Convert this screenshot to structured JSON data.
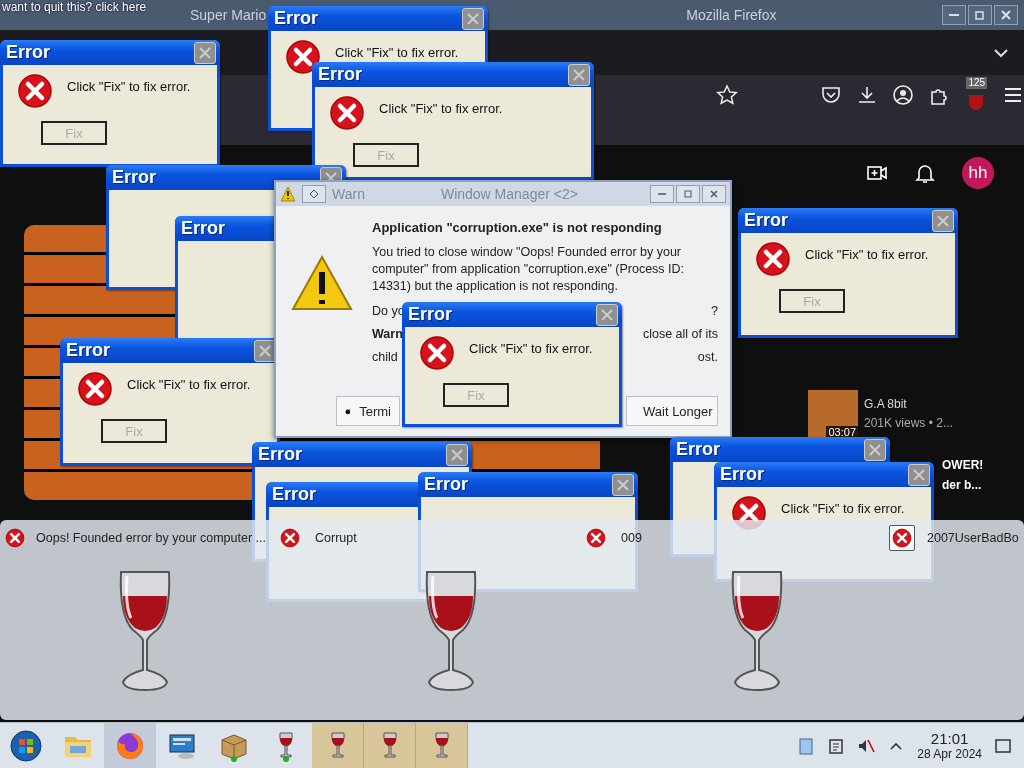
{
  "overlay_link": "want to quit this? click here",
  "browser": {
    "title_left": "Super Mario",
    "title_right": "Mozilla Firefox",
    "extension_badge": "125",
    "avatar": "hh",
    "video": {
      "channel": "G.A 8bit",
      "meta": "201K views • 2...",
      "duration": "03:07"
    },
    "fragments": [
      "OWER!",
      "der b..."
    ]
  },
  "error_windows": [
    {
      "title": "Error",
      "message": "Click \"Fix\" to fix error.",
      "button": "Fix"
    },
    {
      "title": "Error",
      "message": "Click \"Fix\" to fix error."
    },
    {
      "title": "Error",
      "message": "Click \"Fix\" to fix error.",
      "button": "Fix"
    },
    {
      "title": "Error"
    },
    {
      "title": "Error"
    },
    {
      "title": "Error",
      "message": "Click \"Fix\" to fix error.",
      "button": "Fix"
    },
    {
      "title": "Error",
      "message": "Click \"Fix\" to fix error.",
      "button": "Fix"
    },
    {
      "title": "Error"
    },
    {
      "title": "Error"
    },
    {
      "title": "Error"
    },
    {
      "title": "Error"
    },
    {
      "title": "Error",
      "message": "Click \"Fix\" to fix error."
    }
  ],
  "warning_dialog": {
    "title_left": "Warn",
    "title_right": "Window Manager <2>",
    "heading": "Application \"corruption.exe\" is not responding",
    "body": "You tried to close window \"Oops! Founded error by your computer\" from application \"corruption.exe\" (Process ID: 14331) but the application is not responding.",
    "rows": [
      {
        "left": "Do yo",
        "right": "?"
      },
      {
        "left": "**Warn**",
        "right": "close all of its"
      },
      {
        "left": "child",
        "right": "ost."
      }
    ],
    "buttons": [
      "Termi",
      "Wait Longer"
    ]
  },
  "top_error": {
    "title": "Error",
    "message": "Click \"Fix\" to fix error.",
    "button": "Fix"
  },
  "switcher": {
    "items": [
      {
        "label": "Oops! Founded error by your computer ...",
        "selected": false
      },
      {
        "label": "Corrupt",
        "selected": false
      },
      {
        "label": "009",
        "selected": false
      },
      {
        "label": "2007UserBadBo",
        "selected": true
      }
    ]
  },
  "taskbar": {
    "apps": [
      {
        "kind": "start",
        "active": false,
        "attention": false
      },
      {
        "kind": "folder",
        "active": false,
        "attention": false
      },
      {
        "kind": "firefox",
        "active": true,
        "attention": false
      },
      {
        "kind": "monitor",
        "active": false,
        "attention": false
      },
      {
        "kind": "package",
        "active": false,
        "attention": false
      },
      {
        "kind": "wine-new",
        "active": false,
        "attention": false
      },
      {
        "kind": "wine",
        "active": false,
        "attention": true
      },
      {
        "kind": "wine",
        "active": false,
        "attention": true
      },
      {
        "kind": "wine",
        "active": false,
        "attention": true
      }
    ],
    "time": "21:01",
    "date": "28 Apr 2024"
  }
}
